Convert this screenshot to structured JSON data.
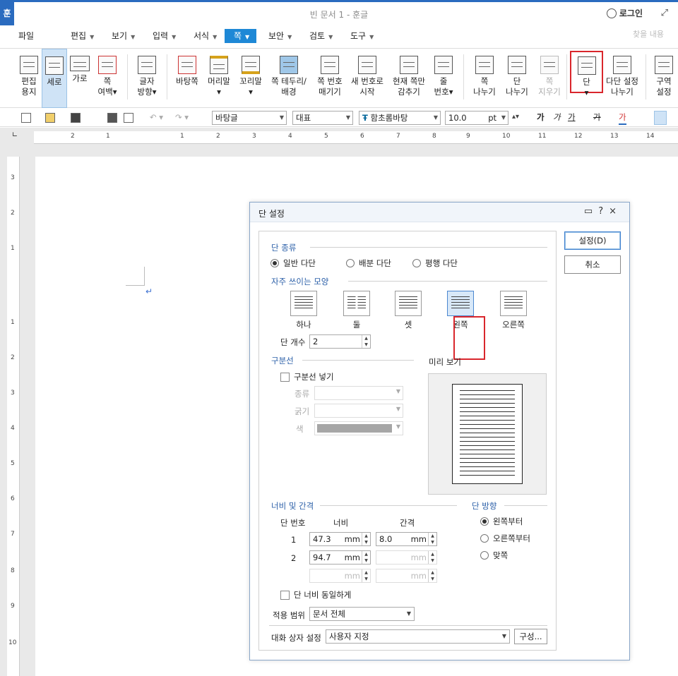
{
  "app": {
    "title": "빈 문서 1 - 훈글",
    "logo": "훈",
    "login": "로그인"
  },
  "menu": {
    "items": [
      {
        "label": "파일",
        "dropdown": false
      },
      {
        "label": "편집",
        "dropdown": true
      },
      {
        "label": "보기",
        "dropdown": true
      },
      {
        "label": "입력",
        "dropdown": true
      },
      {
        "label": "서식",
        "dropdown": true
      },
      {
        "label": "쪽",
        "dropdown": true,
        "active": true
      },
      {
        "label": "보안",
        "dropdown": true
      },
      {
        "label": "검토",
        "dropdown": true
      },
      {
        "label": "도구",
        "dropdown": true
      }
    ],
    "search_placeholder": "찾을 내용"
  },
  "ribbon": {
    "items": [
      {
        "label1": "편집",
        "label2": "용지"
      },
      {
        "label1": "세로",
        "label2": "",
        "selected": true
      },
      {
        "label1": "가로",
        "label2": ""
      },
      {
        "label1": "쪽",
        "label2": "여백▾"
      },
      {
        "label1": "글자",
        "label2": "방향▾"
      },
      {
        "label1": "바탕쪽",
        "label2": ""
      },
      {
        "label1": "머리말",
        "label2": "▾"
      },
      {
        "label1": "꼬리말",
        "label2": "▾"
      },
      {
        "label1": "쪽 테두리/",
        "label2": "배경"
      },
      {
        "label1": "쪽 번호",
        "label2": "매기기"
      },
      {
        "label1": "새 번호로",
        "label2": "시작"
      },
      {
        "label1": "현재 쪽만",
        "label2": "감추기"
      },
      {
        "label1": "줄",
        "label2": "번호▾"
      },
      {
        "label1": "쪽",
        "label2": "나누기"
      },
      {
        "label1": "단",
        "label2": "나누기"
      },
      {
        "label1": "쪽",
        "label2": "지우기",
        "disabled": true
      },
      {
        "label1": "단",
        "label2": "▾",
        "highlighted": true
      },
      {
        "label1": "다단 설정",
        "label2": "나누기"
      },
      {
        "label1": "구역",
        "label2": "설정"
      }
    ]
  },
  "toolbar": {
    "style": "바탕글",
    "lang": "대표",
    "font": "함초롬바탕",
    "size": "10.0",
    "unit": "pt",
    "bold": "가",
    "italic": "가",
    "underline": "가",
    "strike": "가",
    "color": "가"
  },
  "ruler": {
    "h": [
      "2",
      "1",
      "1",
      "2",
      "3",
      "4",
      "5",
      "6",
      "7",
      "8",
      "9",
      "10",
      "11",
      "12",
      "13",
      "14"
    ],
    "v": [
      "3",
      "2",
      "1",
      "1",
      "2",
      "3",
      "4",
      "5",
      "6",
      "7",
      "8",
      "9",
      "10"
    ]
  },
  "dialog": {
    "title": "단 설정",
    "help": "?",
    "close": "×",
    "col_type": {
      "title": "단 종류",
      "options": [
        {
          "label": "일반 다단",
          "checked": true
        },
        {
          "label": "배분 다단",
          "checked": false
        },
        {
          "label": "평행 다단",
          "checked": false
        }
      ]
    },
    "presets": {
      "title": "자주 쓰이는 모양",
      "items": [
        {
          "label": "하나",
          "selected": false
        },
        {
          "label": "둘",
          "selected": false
        },
        {
          "label": "셋",
          "selected": false
        },
        {
          "label": "왼쪽",
          "selected": true
        },
        {
          "label": "오른쪽",
          "selected": false
        }
      ]
    },
    "col_count_label": "단 개수",
    "col_count": "2",
    "divider": {
      "title": "구분선",
      "insert_label": "구분선 넣기",
      "type_label": "종류",
      "thickness_label": "굵기",
      "color_label": "색",
      "color": "#a6a6a6"
    },
    "preview_title": "미리 보기",
    "width_gap": {
      "title": "너비 및 간격",
      "col_no": "단 번호",
      "width": "너비",
      "gap": "간격",
      "unit": "mm",
      "rows": [
        {
          "no": "1",
          "width": "47.3",
          "gap": "8.0"
        },
        {
          "no": "2",
          "width": "94.7",
          "gap": ""
        },
        {
          "no": "",
          "width": "",
          "gap": ""
        }
      ]
    },
    "direction": {
      "title": "단 방향",
      "options": [
        {
          "label": "왼쪽부터",
          "checked": true
        },
        {
          "label": "오른쪽부터",
          "checked": false
        },
        {
          "label": "맞쪽",
          "checked": false
        }
      ]
    },
    "equal_width": "단 너비 동일하게",
    "apply_label": "적용 범위",
    "apply_value": "문서 전체",
    "dlg_setting_label": "대화 상자 설정",
    "dlg_setting_value": "사용자 지정",
    "compose": "구성...",
    "ok": "설정(D)",
    "cancel": "취소"
  }
}
